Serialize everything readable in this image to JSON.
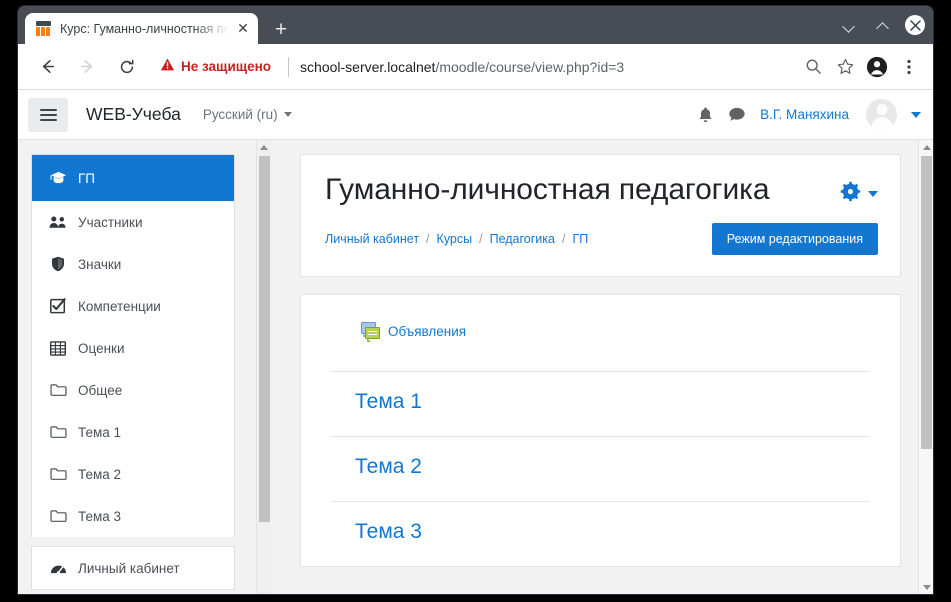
{
  "browser": {
    "tab": {
      "title": "Курс: Гуманно-личностная пе",
      "favicon": "moodle-logo-icon",
      "close_label": "✕"
    },
    "new_tab_label": "+",
    "window_controls": {
      "minimize": "chevron-down-icon",
      "maximize": "chevron-up-icon",
      "close": "close-circle-icon"
    },
    "toolbar": {
      "back": "back-arrow-icon",
      "forward": "forward-arrow-icon",
      "reload": "reload-icon",
      "security_label": "Не защищено",
      "security_icon": "warning-triangle-icon",
      "security_color": "#c5221f",
      "url_host": "school-server.localnet",
      "url_path": "/moodle/course/view.php?id=3",
      "zoom_icon": "search-zoom-icon",
      "bookmark_icon": "star-icon",
      "profile_icon": "profile-avatar-icon",
      "menu_icon": "three-dots-menu-icon"
    }
  },
  "navbar": {
    "hamburger": "hamburger-menu-icon",
    "site_name": "WEB-Учеба",
    "language": "Русский (ru)",
    "notifications_icon": "bell-icon",
    "messages_icon": "chat-bubble-icon",
    "user_name": "В.Г. Маняхина",
    "avatar": "user-avatar-icon"
  },
  "sidebar": {
    "groups": [
      {
        "items": [
          {
            "label": "ГП",
            "icon": "graduation-cap-icon",
            "active": true
          },
          {
            "label": "Участники",
            "icon": "users-icon",
            "active": false
          },
          {
            "label": "Значки",
            "icon": "shield-icon",
            "active": false
          },
          {
            "label": "Компетенции",
            "icon": "checkbox-checked-icon",
            "active": false
          },
          {
            "label": "Оценки",
            "icon": "table-grid-icon",
            "active": false
          },
          {
            "label": "Общее",
            "icon": "folder-icon",
            "active": false
          },
          {
            "label": "Тема 1",
            "icon": "folder-icon",
            "active": false
          },
          {
            "label": "Тема 2",
            "icon": "folder-icon",
            "active": false
          },
          {
            "label": "Тема 3",
            "icon": "folder-icon",
            "active": false
          }
        ]
      },
      {
        "items": [
          {
            "label": "Личный кабинет",
            "icon": "dashboard-icon",
            "active": false
          }
        ]
      }
    ]
  },
  "main": {
    "course_title": "Гуманно-личностная педагогика",
    "gear_icon": "gear-icon",
    "gear_caret": "caret-down-icon",
    "gear_color": "#1177d1",
    "breadcrumb": [
      "Личный кабинет",
      "Курсы",
      "Педагогика",
      "ГП"
    ],
    "breadcrumb_separator": "/",
    "edit_mode_button": "Режим редактирования",
    "accent_color": "#1177d1",
    "announcements": {
      "label": "Объявления",
      "icon": "forum-speech-bubbles-icon"
    },
    "topics": [
      {
        "title": "Тема 1"
      },
      {
        "title": "Тема 2"
      },
      {
        "title": "Тема 3"
      }
    ]
  },
  "scrollbars": {
    "up_arrow": "scroll-up-arrow-icon",
    "down_arrow": "scroll-down-arrow-icon"
  }
}
